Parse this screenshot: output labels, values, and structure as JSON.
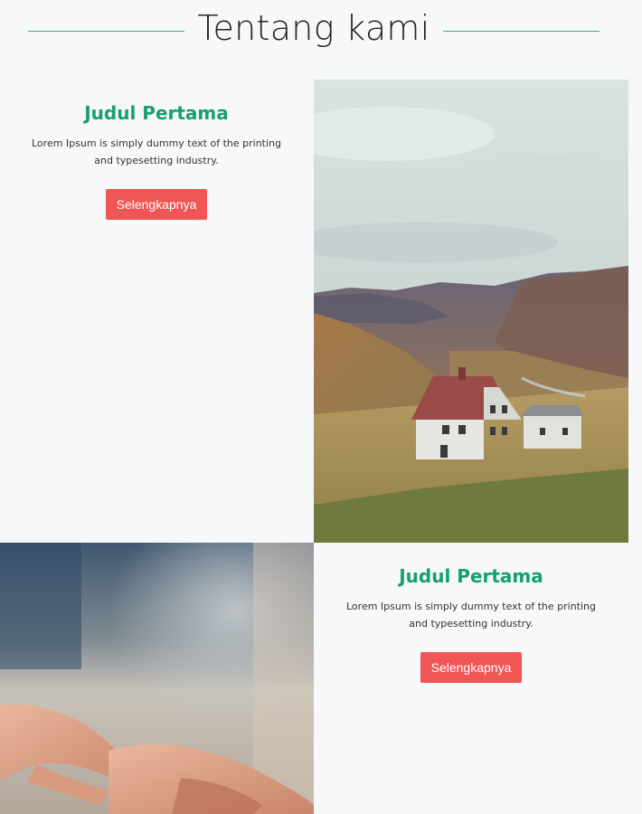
{
  "section": {
    "title": "Tentang kami"
  },
  "cards": [
    {
      "title": "Judul Pertama",
      "description": "Lorem Ipsum is simply dummy text of the printing and typesetting industry.",
      "button_label": "Selengkapnya"
    },
    {
      "title": "Judul Pertama",
      "description": "Lorem Ipsum is simply dummy text of the printing and typesetting industry.",
      "button_label": "Selengkapnya"
    }
  ],
  "images": [
    {
      "subject": "white-house-in-mountain-valley"
    },
    {
      "subject": "hands-typing-on-keyboard"
    }
  ],
  "colors": {
    "accent": "#16a06d",
    "button": "#f05656",
    "background": "#f7f8fa"
  }
}
